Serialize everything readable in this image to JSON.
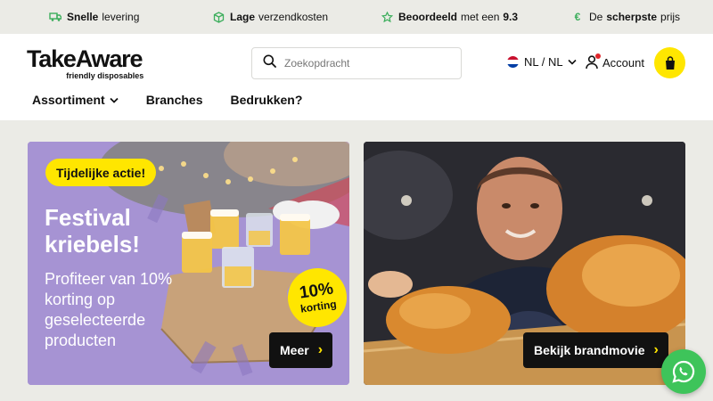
{
  "usp": [
    {
      "bold": "Snelle",
      "text": "levering",
      "tail": "",
      "icon": "truck-icon"
    },
    {
      "bold": "Lage",
      "text": "verzendkosten",
      "tail": "",
      "icon": "box-icon"
    },
    {
      "bold": "Beoordeeld",
      "text": "met een",
      "tail": "9.3",
      "icon": "star-icon"
    },
    {
      "bold": "scherpste",
      "prefix": "De",
      "text": "prijs",
      "tail": "",
      "icon": "euro-icon"
    }
  ],
  "header": {
    "logo_word": "TakeAware",
    "logo_tagline": "friendly disposables",
    "search_placeholder": "Zoekopdracht",
    "language": "NL / NL",
    "account_label": "Account"
  },
  "nav": {
    "items": [
      {
        "label": "Assortiment",
        "has_dropdown": true
      },
      {
        "label": "Branches",
        "has_dropdown": false
      },
      {
        "label": "Bedrukken?",
        "has_dropdown": false
      }
    ]
  },
  "banner_left": {
    "badge": "Tijdelijke actie!",
    "title": "Festival kriebels!",
    "text": "Profiteer van 10% korting op geselecteerde producten",
    "discount_pct": "10%",
    "discount_label": "korting",
    "button": "Meer"
  },
  "banner_right": {
    "button": "Bekijk brandmovie"
  },
  "colors": {
    "accent_yellow": "#ffe600",
    "usp_green": "#3cae5c",
    "banner_purple": "#a693d3",
    "whatsapp_green": "#3ec45a"
  }
}
